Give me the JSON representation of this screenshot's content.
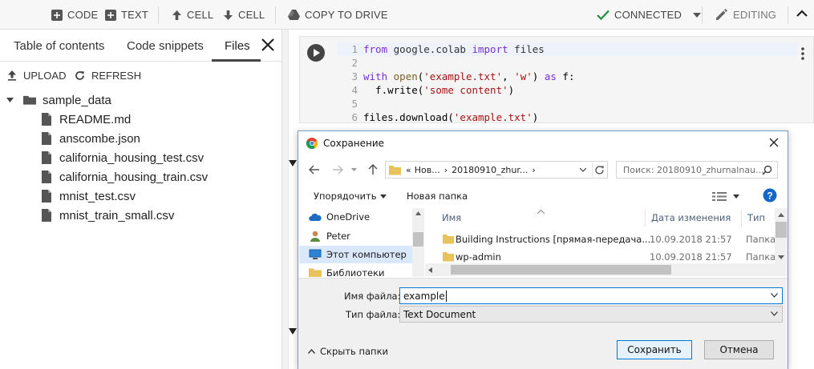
{
  "toolbar": {
    "code_label": "CODE",
    "text_label": "TEXT",
    "cell_up_label": "CELL",
    "cell_down_label": "CELL",
    "copy_drive_label": "COPY TO DRIVE",
    "connected_label": "CONNECTED",
    "editing_label": "EDITING"
  },
  "sidebar": {
    "tabs": [
      {
        "label": "Table of contents"
      },
      {
        "label": "Code snippets"
      },
      {
        "label": "Files"
      }
    ],
    "active_tab": "Files",
    "upload_label": "UPLOAD",
    "refresh_label": "REFRESH",
    "folder": "sample_data",
    "files": [
      "README.md",
      "anscombe.json",
      "california_housing_test.csv",
      "california_housing_train.csv",
      "mnist_test.csv",
      "mnist_train_small.csv"
    ]
  },
  "cell": {
    "line_numbers": [
      "1",
      "2",
      "3",
      "4",
      "5",
      "6"
    ],
    "lines": {
      "l1": {
        "kw1": "from",
        "mod": "google.colab",
        "kw2": "import",
        "rest": "files"
      },
      "l3": {
        "kw": "with",
        "fn": "open",
        "p1": "(",
        "s1": "'example.txt'",
        "c": ", ",
        "s2": "'w'",
        "p2": ")",
        "kw2": "as",
        "rest": "f:"
      },
      "l4": {
        "pre": "  f.write(",
        "s": "'some content'",
        "post": ")"
      },
      "l6": {
        "pre": "files.download(",
        "s": "'example.txt'",
        "post": ")"
      }
    }
  },
  "dialog": {
    "title": "Сохранение",
    "breadcrumb": [
      "«",
      "Нов...",
      "›",
      "20180910_zhur...",
      "›"
    ],
    "search_placeholder": "Поиск: 20180910_zhurnalnau...",
    "organize_label": "Упорядочить",
    "new_folder_label": "Новая папка",
    "nav_items": [
      {
        "label": "OneDrive",
        "icon": "cloud-icon"
      },
      {
        "label": "Peter",
        "icon": "user-icon"
      },
      {
        "label": "Этот компьютер",
        "icon": "computer-icon"
      },
      {
        "label": "Библиотеки",
        "icon": "folder-icon"
      }
    ],
    "columns": {
      "name": "Имя",
      "date": "Дата изменения",
      "type": "Тип"
    },
    "rows": [
      {
        "name": "Building Instructions [прямая-передача...",
        "date": "10.09.2018 21:57",
        "type": "Папка"
      },
      {
        "name": "wp-admin",
        "date": "10.09.2018 21:57",
        "type": "Папка"
      }
    ],
    "filename_label": "Имя файла:",
    "filename_value": "example",
    "filetype_label": "Тип файла:",
    "filetype_value": "Text Document",
    "hide_folders_label": "Скрыть папки",
    "save_label": "Сохранить",
    "cancel_label": "Отмена"
  },
  "colors": {
    "accent_green": "#1e8e3e",
    "win_blue": "#0078d7",
    "keyword_purple": "#7b30d0",
    "string_red": "#a31515"
  }
}
